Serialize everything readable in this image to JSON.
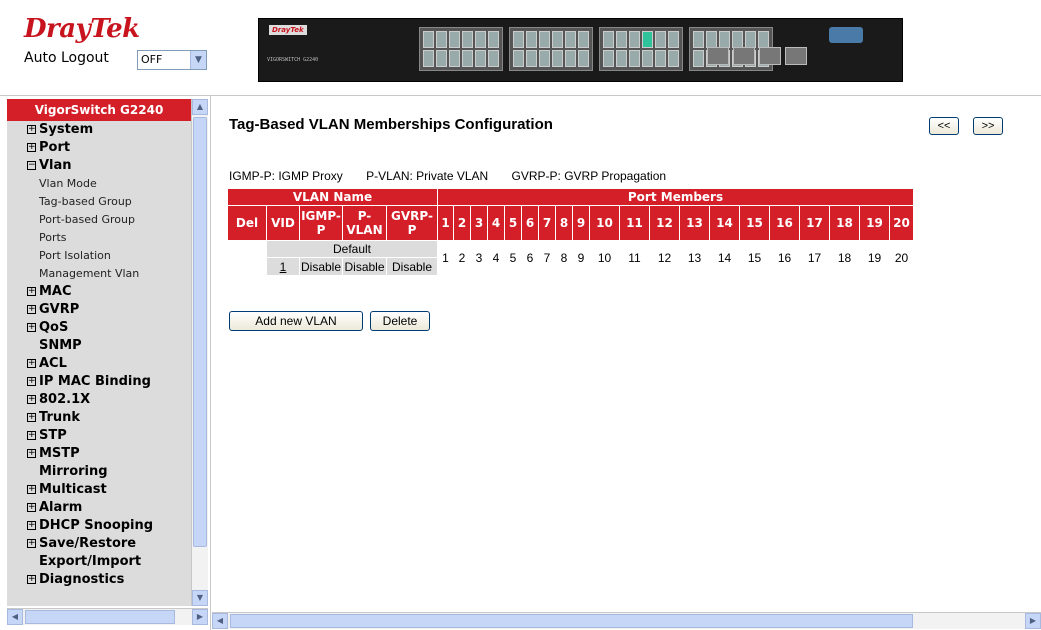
{
  "header": {
    "logo_dray": "Dray",
    "logo_tek": "Tek",
    "auto_logout_label": "Auto Logout",
    "auto_logout_value": "OFF",
    "device_brand": "DrayTek",
    "device_model": "VIGORSWITCH G2240"
  },
  "sidebar": {
    "title": "VigorSwitch G2240",
    "items": [
      {
        "label": "System",
        "type": "main",
        "expander": "+"
      },
      {
        "label": "Port",
        "type": "main",
        "expander": "+"
      },
      {
        "label": "Vlan",
        "type": "main",
        "expander": "−"
      },
      {
        "label": "Vlan Mode",
        "type": "sub"
      },
      {
        "label": "Tag-based Group",
        "type": "sub"
      },
      {
        "label": "Port-based Group",
        "type": "sub"
      },
      {
        "label": "Ports",
        "type": "sub"
      },
      {
        "label": "Port Isolation",
        "type": "sub"
      },
      {
        "label": "Management Vlan",
        "type": "sub"
      },
      {
        "label": "MAC",
        "type": "main",
        "expander": "+"
      },
      {
        "label": "GVRP",
        "type": "main",
        "expander": "+"
      },
      {
        "label": "QoS",
        "type": "main",
        "expander": "+"
      },
      {
        "label": "SNMP",
        "type": "main",
        "expander": ""
      },
      {
        "label": "ACL",
        "type": "main",
        "expander": "+"
      },
      {
        "label": "IP MAC Binding",
        "type": "main",
        "expander": "+"
      },
      {
        "label": "802.1X",
        "type": "main",
        "expander": "+"
      },
      {
        "label": "Trunk",
        "type": "main",
        "expander": "+"
      },
      {
        "label": "STP",
        "type": "main",
        "expander": "+"
      },
      {
        "label": "MSTP",
        "type": "main",
        "expander": "+"
      },
      {
        "label": "Mirroring",
        "type": "main",
        "expander": ""
      },
      {
        "label": "Multicast",
        "type": "main",
        "expander": "+"
      },
      {
        "label": "Alarm",
        "type": "main",
        "expander": "+"
      },
      {
        "label": "DHCP Snooping",
        "type": "main",
        "expander": "+"
      },
      {
        "label": "Save/Restore",
        "type": "main",
        "expander": "+"
      },
      {
        "label": "Export/Import",
        "type": "main",
        "expander": ""
      },
      {
        "label": "Diagnostics",
        "type": "main",
        "expander": "+"
      }
    ]
  },
  "main": {
    "title": "Tag-Based VLAN Memberships Configuration",
    "prev_label": "<<",
    "next_label": ">>",
    "legend": {
      "igmp": "IGMP-P: IGMP Proxy",
      "pvlan": "P-VLAN: Private VLAN",
      "gvrp": "GVRP-P: GVRP Propagation"
    },
    "table": {
      "vlan_name_header": "VLAN Name",
      "port_members_header": "Port Members",
      "col_del": "Del",
      "col_vid": "VID",
      "col_igmp": "IGMP-P",
      "col_pvlan": "P-VLAN",
      "col_gvrp": "GVRP-P",
      "ports": [
        "1",
        "2",
        "3",
        "4",
        "5",
        "6",
        "7",
        "8",
        "9",
        "10",
        "11",
        "12",
        "13",
        "14",
        "15",
        "16",
        "17",
        "18",
        "19",
        "20"
      ],
      "row": {
        "name": "Default",
        "vid": "1",
        "igmp": "Disable",
        "pvlan": "Disable",
        "gvrp": "Disable",
        "members": [
          "1",
          "2",
          "3",
          "4",
          "5",
          "6",
          "7",
          "8",
          "9",
          "10",
          "11",
          "12",
          "13",
          "14",
          "15",
          "16",
          "17",
          "18",
          "19",
          "20"
        ]
      }
    },
    "add_label": "Add new VLAN",
    "delete_label": "Delete"
  },
  "colors": {
    "brand_red": "#d41e28",
    "sidebar_bg": "#dcdcdc",
    "scroll_blue": "#c6d6f7"
  }
}
